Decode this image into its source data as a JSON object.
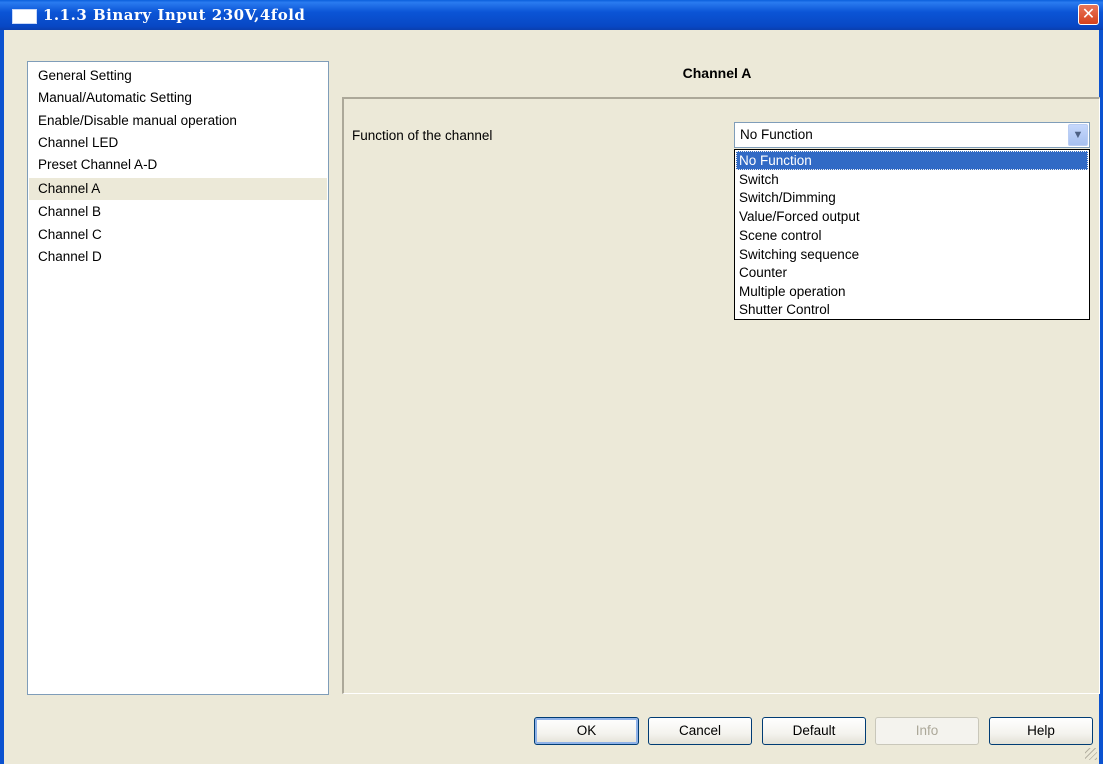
{
  "window": {
    "title": "1.1.3 Binary Input 230V,4fold",
    "close_label": "✕"
  },
  "tree": {
    "items": [
      {
        "label": "General Setting",
        "selected": false
      },
      {
        "label": "Manual/Automatic Setting",
        "selected": false
      },
      {
        "label": "Enable/Disable manual operation",
        "selected": false
      },
      {
        "label": "Channel LED",
        "selected": false
      },
      {
        "label": "Preset Channel A-D",
        "selected": false
      },
      {
        "label": "Channel A",
        "selected": true
      },
      {
        "label": "Channel B",
        "selected": false
      },
      {
        "label": "Channel C",
        "selected": false
      },
      {
        "label": "Channel D",
        "selected": false
      }
    ]
  },
  "panel": {
    "title": "Channel A",
    "function_label": "Function of the channel",
    "function_value": "No Function",
    "arrow_icon": "chevron-down-icon",
    "options": [
      "No Function",
      "Switch",
      "Switch/Dimming",
      "Value/Forced output",
      "Scene control",
      "Switching sequence",
      "Counter",
      "Multiple operation",
      "Shutter Control"
    ],
    "highlighted_option_index": 0
  },
  "buttons": {
    "ok": "OK",
    "cancel": "Cancel",
    "default": "Default",
    "info": "Info",
    "help": "Help"
  },
  "colors": {
    "titlebar": "#0b55d6",
    "dialog_bg": "#ece9d8",
    "selection": "#316ac5"
  }
}
